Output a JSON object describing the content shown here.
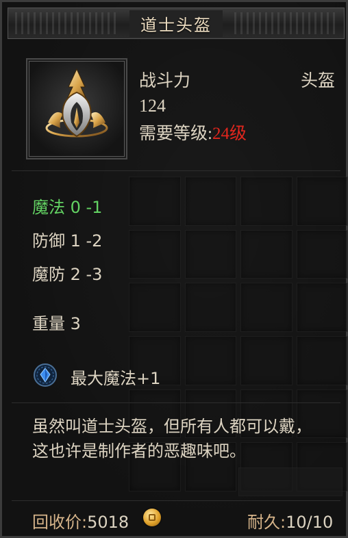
{
  "window": {
    "title": "道士头盔"
  },
  "item": {
    "icon": "helmet-icon",
    "power_label": "战斗力",
    "power_value": "124",
    "type": "头盔",
    "requirement_label": "需要等级:",
    "requirement_value": "24级"
  },
  "attributes": [
    {
      "text": "魔法 0 -1",
      "color": "#63d363"
    },
    {
      "text": "防御 1 -2"
    },
    {
      "text": "魔防 2 -3"
    },
    {
      "text": "重量 3"
    }
  ],
  "bonus": {
    "icon": "blue-gem-icon",
    "text": "最大魔法+1"
  },
  "description": "虽然叫道士头盔，但所有人都可以戴，这也许是制作者的恶趣味吧。",
  "footer": {
    "recycle_label": "回收价:",
    "recycle_value": "5018",
    "currency_icon": "gold-coin-icon",
    "durability_label": "耐久:",
    "durability_value": "10/10"
  },
  "colors": {
    "text": "#ddd4c2",
    "highlight_green": "#63d363",
    "requirement_red": "#e0261d",
    "footer_gold": "#d6b48a"
  }
}
